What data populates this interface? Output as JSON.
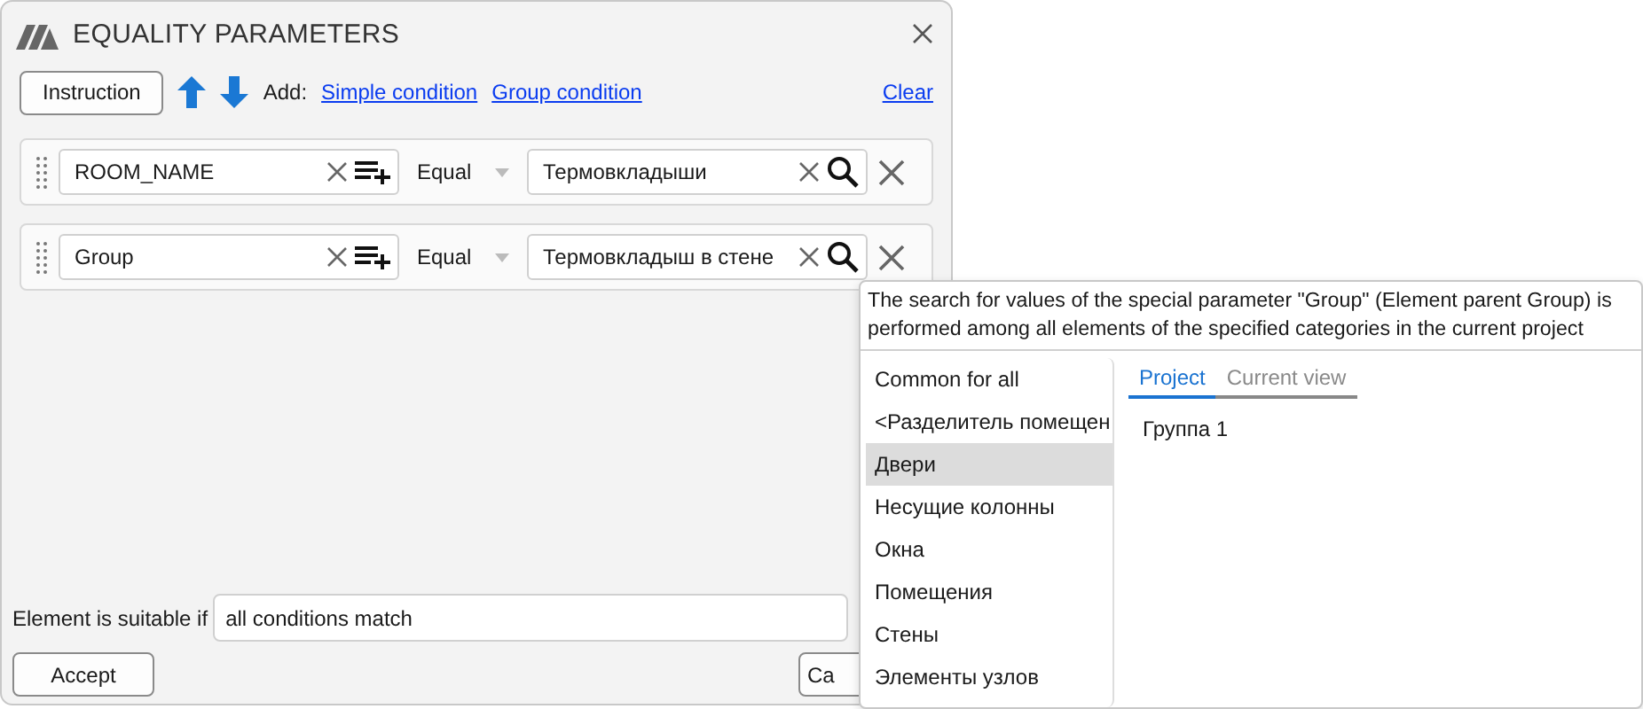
{
  "window": {
    "title": "EQUALITY PARAMETERS"
  },
  "toolbar": {
    "instruction_button": "Instruction",
    "add_label": "Add:",
    "links": [
      "Simple condition",
      "Group condition"
    ],
    "clear_link": "Clear"
  },
  "conditions": [
    {
      "parameter": "ROOM_NAME",
      "operator": "Equal",
      "value": "Термовкладыши"
    },
    {
      "parameter": "Group",
      "operator": "Equal",
      "value": "Термовкладыш в стене"
    }
  ],
  "footer": {
    "label": "Element is suitable if",
    "mode": "all conditions match",
    "accept_button": "Accept",
    "cancel_button": "Ca"
  },
  "popup": {
    "description": "The search for values of the special parameter \"Group\" (Element parent Group) is performed among all elements of the specified categories in the current project",
    "categories": [
      {
        "label": "Common for all",
        "selected": false
      },
      {
        "label": "<Разделитель помещен",
        "selected": false
      },
      {
        "label": "Двери",
        "selected": true
      },
      {
        "label": "Несущие колонны",
        "selected": false
      },
      {
        "label": "Окна",
        "selected": false
      },
      {
        "label": "Помещения",
        "selected": false
      },
      {
        "label": "Стены",
        "selected": false
      },
      {
        "label": "Элементы узлов",
        "selected": false
      }
    ],
    "tabs": [
      {
        "label": "Project",
        "selected": true
      },
      {
        "label": "Current view",
        "selected": false
      }
    ],
    "values": [
      "Группа 1"
    ]
  }
}
